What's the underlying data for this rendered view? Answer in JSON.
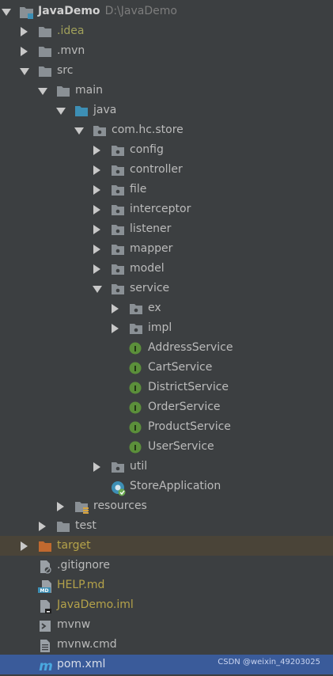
{
  "project": {
    "name": "JavaDemo",
    "path": "D:\\JavaDemo"
  },
  "tree": {
    "idea": ".idea",
    "mvn": ".mvn",
    "src": "src",
    "main": "main",
    "java": "java",
    "package": "com.hc.store",
    "config": "config",
    "controller": "controller",
    "file": "file",
    "interceptor": "interceptor",
    "listener": "listener",
    "mapper": "mapper",
    "model": "model",
    "service": "service",
    "ex": "ex",
    "impl": "impl",
    "interfaces": [
      "AddressService",
      "CartService",
      "DistrictService",
      "OrderService",
      "ProductService",
      "UserService"
    ],
    "util": "util",
    "app": "StoreApplication",
    "resources": "resources",
    "test": "test",
    "target": "target",
    "gitignore": ".gitignore",
    "help": "HELP.md",
    "iml": "JavaDemo.iml",
    "mvnw": "mvnw",
    "mvnwcmd": "mvnw.cmd",
    "pom": "pom.xml"
  },
  "interface_badge": "I",
  "watermark": "CSDN @weixin_49203025",
  "colors": {
    "background": "#3c3f41",
    "selected": "#3a5b9a",
    "target_row": "#4a4438",
    "folder": "#8a9095",
    "source_folder": "#3d8fb5",
    "interface_badge": "#5b8f3a"
  }
}
